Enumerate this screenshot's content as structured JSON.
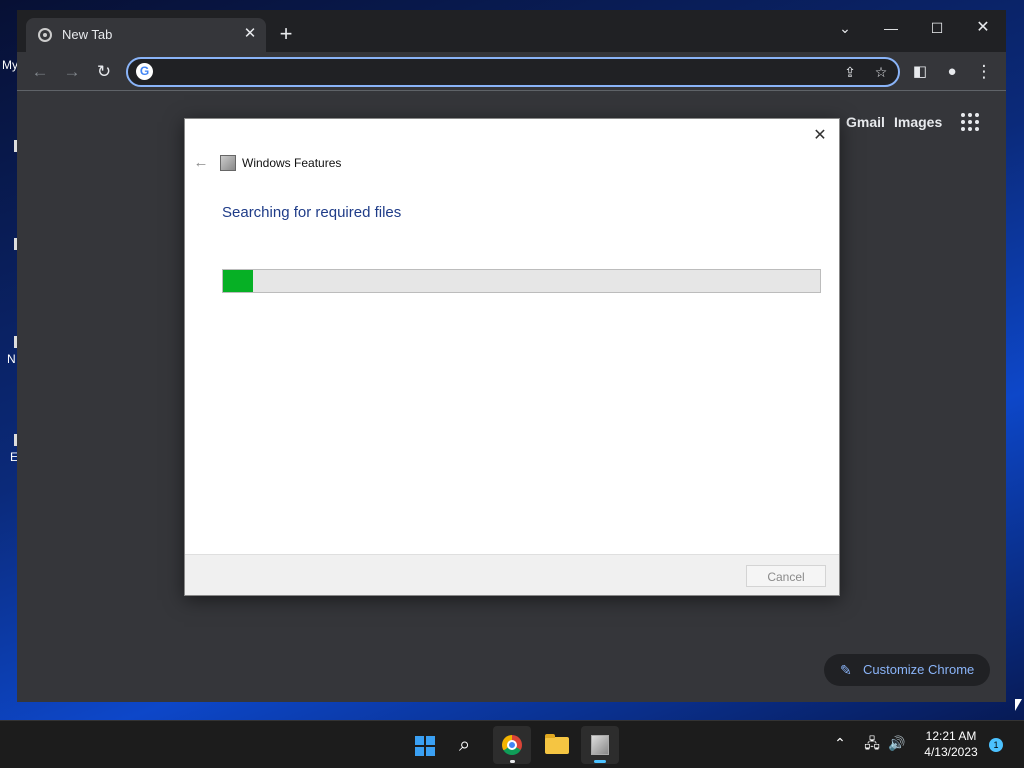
{
  "desktop": {
    "labels": [
      "My",
      "N",
      "E"
    ]
  },
  "browser": {
    "tab_title": "New Tab",
    "omnibox_value": "",
    "top_links": {
      "gmail": "Gmail",
      "images": "Images"
    },
    "customize_label": "Customize Chrome"
  },
  "dialog": {
    "app_title": "Windows Features",
    "heading": "Searching for required files",
    "progress_percent": 5,
    "cancel_label": "Cancel"
  },
  "taskbar": {
    "time": "12:21 AM",
    "date": "4/13/2023",
    "notification_count": "1"
  },
  "colors": {
    "progress_fill": "#06b025",
    "heading_blue": "#1f3c88",
    "omnibox_focus": "#8ab4f8"
  }
}
